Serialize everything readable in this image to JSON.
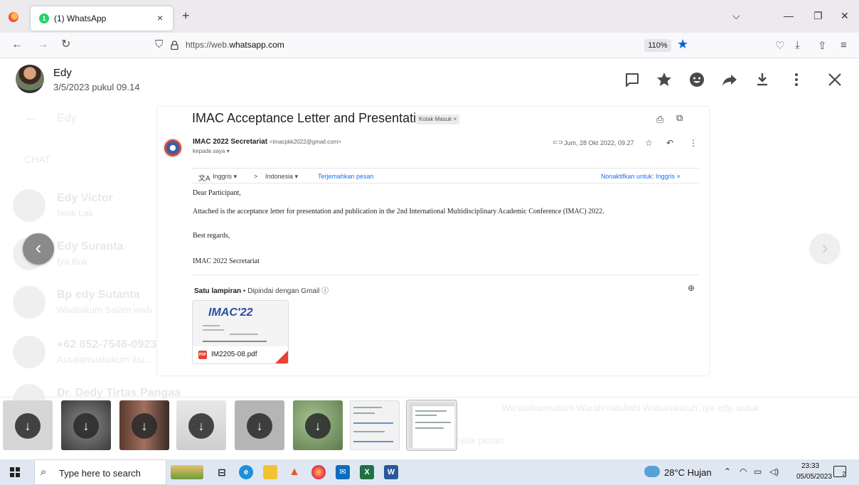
{
  "browser": {
    "tab_badge": "1",
    "tab_title": "(1) WhatsApp",
    "tab_close": "×",
    "new_tab": "+",
    "url_prefix": "https://web.",
    "url_host": "whatsapp.com",
    "zoom": "110%"
  },
  "background_chats": {
    "header_title": "Edy",
    "section": "CHAT",
    "rows": [
      {
        "name": "Edy Victor",
        "sub": "Iwok Lak"
      },
      {
        "name": "Edy Suranta",
        "sub": "Iya Buk"
      },
      {
        "name": "Bp edy Sutanta",
        "sub": "Waalaikum Salam wwb"
      },
      {
        "name": "+62 852-7546-0923",
        "sub": "Assalamualaikum ibu..."
      },
      {
        "name": "Dr. Dedy Tirtas Pangaa",
        "sub": ""
      }
    ],
    "reply_preview": "Wa'alaikumsalam Warahmatullahi Wabarakatuh, iya edy, untuk",
    "composer_placeholder": "Ketik pesan"
  },
  "viewer": {
    "sender_name": "Edy",
    "sender_time": "3/5/2023 pukul 09.14",
    "prev_arrow": "‹",
    "next_arrow": "›"
  },
  "email": {
    "subject": "IMAC Acceptance Letter and Presentation",
    "label_chip": "Kotak Masuk ×",
    "from_name": "IMAC 2022 Secretariat",
    "from_email": "<imacpkk2022@gmail.com>",
    "to_line": "kepada saya ▾",
    "date": "Jum, 28 Okt 2022, 09.27",
    "translate_from": "Inggris ▾",
    "translate_arrow": ">",
    "translate_to": "Indonesia ▾",
    "translate_link": "Terjemahkan pesan",
    "translate_disable": "Nonaktifkan untuk: Inggris ×",
    "body": {
      "greeting": "Dear Participant,",
      "line1": "Attached is the acceptance letter for presentation and publication in the 2nd International Multidisciplinary Academic Conference (IMAC) 2022.",
      "closing": "Best regards,",
      "signature": "IMAC 2022 Secretariat"
    },
    "attachment_header_bold": "Satu lampiran",
    "attachment_header_rest": " • Dipindai dengan Gmail ⓘ",
    "attachment_logo": "IMAC'22",
    "attachment_name": "IM2205-08.pdf",
    "pdf_label": "PDF"
  },
  "taskbar": {
    "search_placeholder": "Type here to search",
    "weather": "28°C  Hujan",
    "time": "23:33",
    "date": "05/05/2023",
    "notification_count": "2"
  },
  "colors": {
    "whatsapp_green": "#25d366",
    "firefox_blue": "#0061e0",
    "gmail_link": "#1a73e8",
    "pdf_red": "#e54335"
  }
}
